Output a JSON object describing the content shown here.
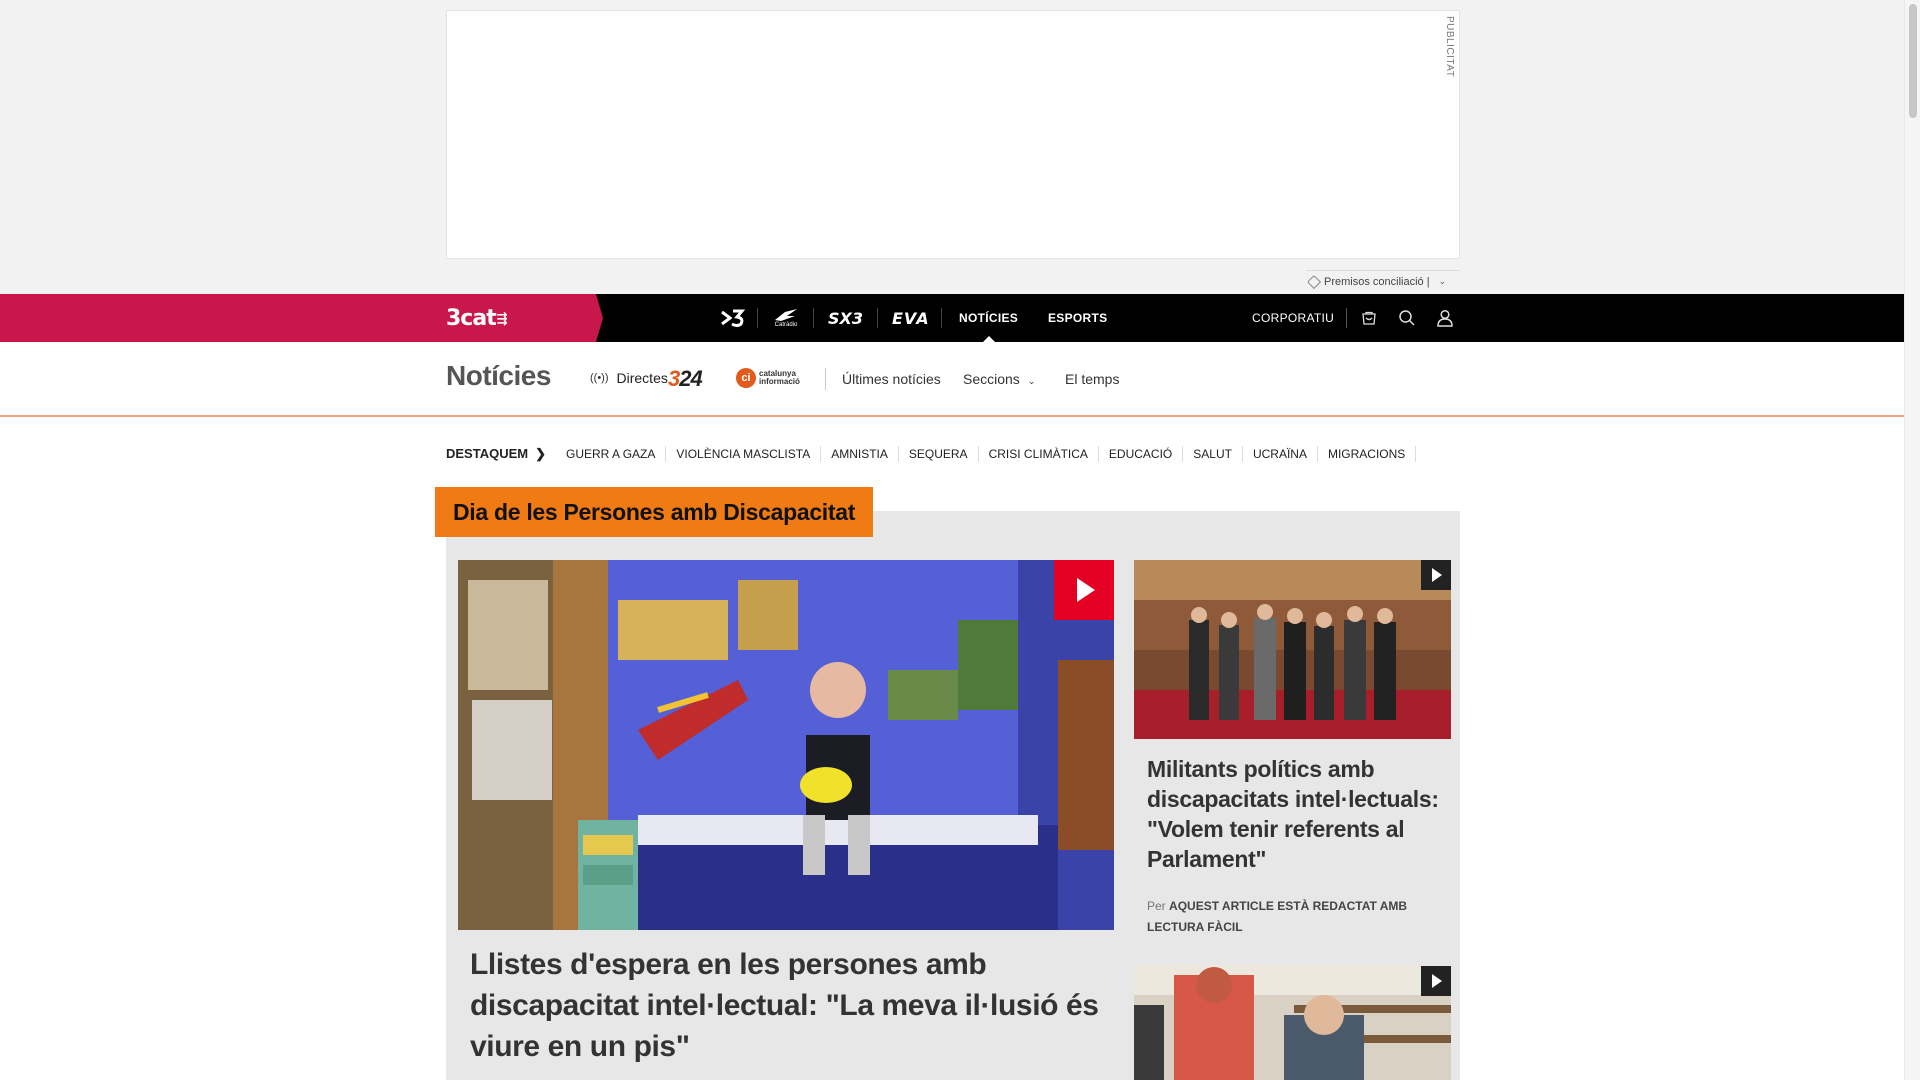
{
  "ad": {
    "label": "PUBLICITAT",
    "sponsor_text": "Premisos conciliació |"
  },
  "topbar": {
    "brand": "3cat",
    "channels": [
      {
        "name": "tv3-logo",
        "label": "3"
      },
      {
        "name": "catradio-logo",
        "label": "Catràdio"
      },
      {
        "name": "sx3-logo",
        "label": "SX3"
      },
      {
        "name": "eva-logo",
        "label": "EVA"
      }
    ],
    "nav_noticies": "NOTÍCIES",
    "nav_esports": "ESPORTS",
    "corporatiu": "CORPORATIU",
    "icons": [
      "cart-icon",
      "search-icon",
      "user-icon"
    ]
  },
  "section": {
    "title": "Notícies",
    "directes": "Directes",
    "logo_324_a": "3",
    "logo_324_b": "24",
    "logo_ci": "catalunya informació",
    "links": [
      "Últimes notícies",
      "Seccions",
      "El temps"
    ]
  },
  "destaquem": {
    "label": "DESTAQUEM",
    "items": [
      "GUERR A GAZA",
      "VIOLÈNCIA MASCLISTA",
      "AMNISTIA",
      "SEQUERA",
      "CRISI CLIMÀTICA",
      "EDUCACIÓ",
      "SALUT",
      "UCRAÏNA",
      "MIGRACIONS"
    ]
  },
  "featured": {
    "title": "Dia de les Persones amb Discapacitat",
    "main_headline": "Llistes d'espera en les persones amb discapacitat intel·lectual: \"La meva il·lusió és viure en un pis\"",
    "side_headline": "Militants polítics amb discapacitats intel·lectuals: \"Volem tenir referents al Parlament\"",
    "byline_prefix": "Per",
    "byline_author": "AQUEST ARTICLE ESTÀ REDACTAT AMB LECTURA FÀCIL"
  },
  "colors": {
    "brand": "#c8174a",
    "accent": "#f07a14",
    "play": "#e30022"
  }
}
